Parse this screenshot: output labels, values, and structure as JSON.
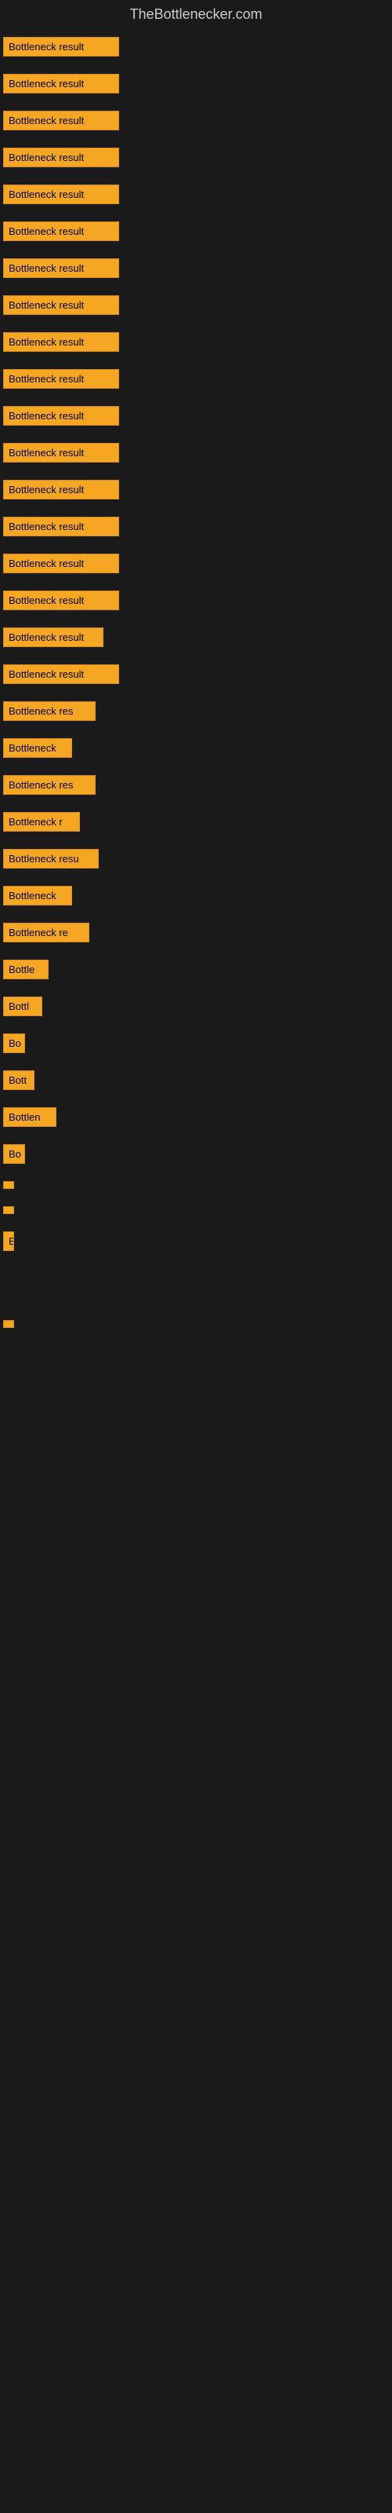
{
  "site": {
    "title": "TheBottlenecker.com"
  },
  "bars": [
    {
      "label": "Bottleneck result",
      "width": 148
    },
    {
      "label": "Bottleneck result",
      "width": 148
    },
    {
      "label": "Bottleneck result",
      "width": 148
    },
    {
      "label": "Bottleneck result",
      "width": 148
    },
    {
      "label": "Bottleneck result",
      "width": 148
    },
    {
      "label": "Bottleneck result",
      "width": 148
    },
    {
      "label": "Bottleneck result",
      "width": 148
    },
    {
      "label": "Bottleneck result",
      "width": 148
    },
    {
      "label": "Bottleneck result",
      "width": 148
    },
    {
      "label": "Bottleneck result",
      "width": 148
    },
    {
      "label": "Bottleneck result",
      "width": 148
    },
    {
      "label": "Bottleneck result",
      "width": 148
    },
    {
      "label": "Bottleneck result",
      "width": 148
    },
    {
      "label": "Bottleneck result",
      "width": 148
    },
    {
      "label": "Bottleneck result",
      "width": 148
    },
    {
      "label": "Bottleneck result",
      "width": 148
    },
    {
      "label": "Bottleneck result",
      "width": 128
    },
    {
      "label": "Bottleneck result",
      "width": 148
    },
    {
      "label": "Bottleneck res",
      "width": 118
    },
    {
      "label": "Bottleneck",
      "width": 88
    },
    {
      "label": "Bottleneck res",
      "width": 118
    },
    {
      "label": "Bottleneck r",
      "width": 98
    },
    {
      "label": "Bottleneck resu",
      "width": 122
    },
    {
      "label": "Bottleneck",
      "width": 88
    },
    {
      "label": "Bottleneck re",
      "width": 110
    },
    {
      "label": "Bottle",
      "width": 58
    },
    {
      "label": "Bottl",
      "width": 50
    },
    {
      "label": "Bo",
      "width": 28
    },
    {
      "label": "Bott",
      "width": 40
    },
    {
      "label": "Bottlen",
      "width": 68
    },
    {
      "label": "Bo",
      "width": 28
    },
    {
      "label": "",
      "width": 6
    },
    {
      "label": "",
      "width": 6
    },
    {
      "label": "B",
      "width": 12
    },
    {
      "label": "",
      "width": 0
    },
    {
      "label": "",
      "width": 0
    },
    {
      "label": "",
      "width": 0
    },
    {
      "label": "",
      "width": 6
    }
  ]
}
